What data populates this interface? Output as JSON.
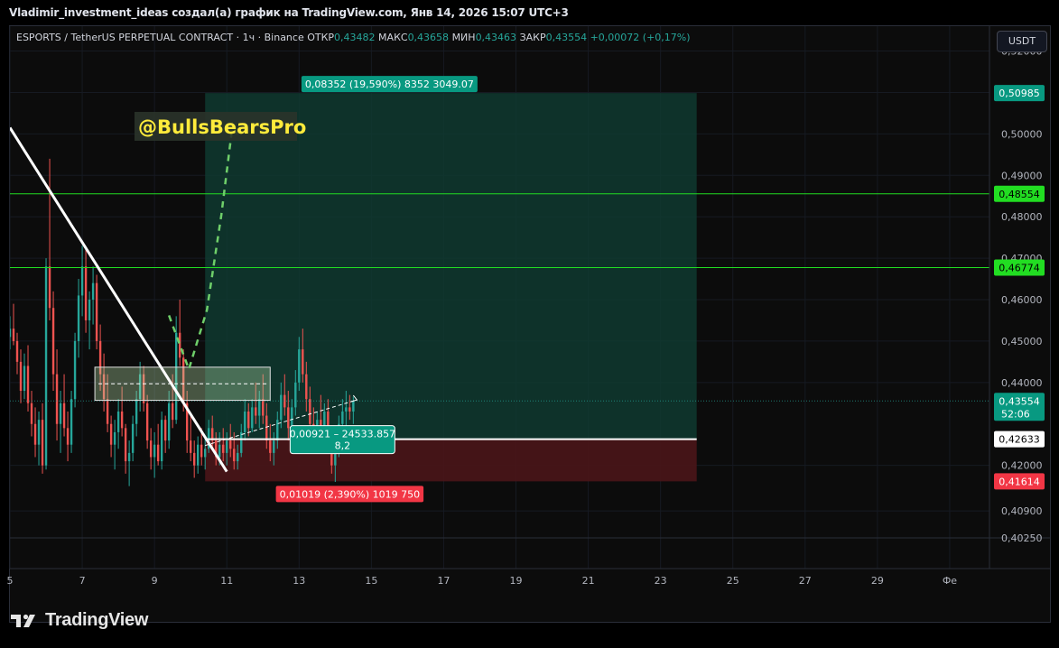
{
  "header": {
    "title": "Vladimir_investment_ideas создал(а) график на TradingView.com, Янв 14, 2026 15:07 UTC+3"
  },
  "legend": {
    "symbol": "ESPORTS / TetherUS PERPETUAL CONTRACT · 1ч · Binance",
    "open_label": "ОТКР",
    "open": "0,43482",
    "high_label": "МАКС",
    "high": "0,43658",
    "low_label": "МИН",
    "low": "0,43463",
    "close_label": "ЗАКР",
    "close": "0,43554",
    "change": "+0,00072 (+0,17%)"
  },
  "currency_button": "USDT",
  "watermark": "@BullsBearsPro",
  "footer": {
    "brand": "TradingView"
  },
  "colors": {
    "up": "#26a69a",
    "down": "#ef5350",
    "target_zone": "#0f3a30",
    "stop_zone": "#4a1518",
    "level_green": "#22dd22",
    "trendline": "#ffffff",
    "watermark_text": "#ffeb3b"
  },
  "chart_data": {
    "type": "candlestick",
    "timeframe": "1h",
    "ylim": [
      0.4025,
      0.526
    ],
    "y_ticks": [
      "0,52000",
      "0,51000",
      "0,50000",
      "0,49000",
      "0,48000",
      "0,47000",
      "0,46000",
      "0,45000",
      "0,44000",
      "0,42000",
      "0,40900",
      "0,40250"
    ],
    "x_ticks": [
      "5",
      "7",
      "9",
      "11",
      "13",
      "15",
      "17",
      "19",
      "21",
      "23",
      "25",
      "27",
      "29",
      "Фе"
    ],
    "x_tick_values": [
      5,
      7,
      9,
      11,
      13,
      15,
      17,
      19,
      21,
      23,
      25,
      27,
      29,
      31
    ],
    "xlim": [
      5,
      32.1
    ],
    "last_price": {
      "value": 0.43554,
      "label": "0,43554",
      "countdown": "52:06"
    },
    "horizontal_levels": [
      {
        "value": 0.48554,
        "label": "0,48554"
      },
      {
        "value": 0.46774,
        "label": "0,46774"
      }
    ],
    "position": {
      "side": "long",
      "entry": 0.42633,
      "entry_label": "0,42633",
      "target": 0.50985,
      "target_label": "0,50985",
      "stop": 0.41614,
      "stop_label": "0,41614",
      "start_day": 10.4,
      "end_day": 24.0,
      "target_text": "0,08352 (19,590%) 8352 3049.07",
      "stop_text": "0,01019 (2,390%) 1019 750",
      "center_text_line1": "0,00921 – 24533.857",
      "center_text_line2": "8,2"
    },
    "trendline": [
      [
        5.0,
        0.5015
      ],
      [
        11.0,
        0.4185
      ]
    ],
    "rectangle": {
      "x1": 7.35,
      "x2": 12.2,
      "top": 0.4437,
      "bottom": 0.4357,
      "mid": 0.4397
    },
    "forecast_path": [
      [
        9.4,
        0.4562
      ],
      [
        9.95,
        0.4432
      ],
      [
        10.45,
        0.4575
      ],
      [
        10.85,
        0.4805
      ],
      [
        11.15,
        0.5015
      ],
      [
        11.05,
        0.5045
      ]
    ],
    "forecast_dashed_line": [
      [
        10.4,
        0.4248
      ],
      [
        14.6,
        0.4358
      ]
    ],
    "candles": [
      [
        5.0,
        0.451,
        0.456,
        0.448,
        0.453
      ],
      [
        5.1,
        0.453,
        0.459,
        0.449,
        0.45
      ],
      [
        5.2,
        0.45,
        0.452,
        0.442,
        0.445
      ],
      [
        5.3,
        0.445,
        0.448,
        0.435,
        0.438
      ],
      [
        5.4,
        0.438,
        0.447,
        0.436,
        0.444
      ],
      [
        5.5,
        0.444,
        0.449,
        0.433,
        0.435
      ],
      [
        5.6,
        0.435,
        0.438,
        0.427,
        0.43
      ],
      [
        5.7,
        0.43,
        0.434,
        0.422,
        0.425
      ],
      [
        5.8,
        0.425,
        0.433,
        0.42,
        0.431
      ],
      [
        5.9,
        0.431,
        0.435,
        0.418,
        0.42
      ],
      [
        6.0,
        0.42,
        0.47,
        0.419,
        0.468
      ],
      [
        6.1,
        0.468,
        0.494,
        0.455,
        0.458
      ],
      [
        6.2,
        0.458,
        0.462,
        0.438,
        0.442
      ],
      [
        6.3,
        0.442,
        0.448,
        0.426,
        0.43
      ],
      [
        6.4,
        0.43,
        0.438,
        0.423,
        0.435
      ],
      [
        6.5,
        0.435,
        0.442,
        0.427,
        0.429
      ],
      [
        6.6,
        0.429,
        0.433,
        0.421,
        0.425
      ],
      [
        6.7,
        0.425,
        0.438,
        0.423,
        0.436
      ],
      [
        6.8,
        0.436,
        0.452,
        0.434,
        0.45
      ],
      [
        6.9,
        0.45,
        0.465,
        0.446,
        0.461
      ],
      [
        7.0,
        0.461,
        0.473,
        0.456,
        0.468
      ],
      [
        7.1,
        0.468,
        0.472,
        0.452,
        0.455
      ],
      [
        7.2,
        0.455,
        0.462,
        0.448,
        0.46
      ],
      [
        7.3,
        0.46,
        0.468,
        0.454,
        0.464
      ],
      [
        7.4,
        0.464,
        0.466,
        0.448,
        0.45
      ],
      [
        7.5,
        0.45,
        0.454,
        0.438,
        0.442
      ],
      [
        7.6,
        0.442,
        0.447,
        0.433,
        0.436
      ],
      [
        7.7,
        0.436,
        0.442,
        0.428,
        0.43
      ],
      [
        7.8,
        0.43,
        0.432,
        0.422,
        0.425
      ],
      [
        7.9,
        0.425,
        0.431,
        0.419,
        0.428
      ],
      [
        8.0,
        0.428,
        0.436,
        0.424,
        0.433
      ],
      [
        8.1,
        0.433,
        0.439,
        0.427,
        0.429
      ],
      [
        8.2,
        0.429,
        0.43,
        0.418,
        0.421
      ],
      [
        8.3,
        0.421,
        0.426,
        0.415,
        0.423
      ],
      [
        8.4,
        0.423,
        0.432,
        0.421,
        0.43
      ],
      [
        8.5,
        0.43,
        0.438,
        0.427,
        0.436
      ],
      [
        8.6,
        0.436,
        0.445,
        0.433,
        0.442
      ],
      [
        8.7,
        0.442,
        0.444,
        0.433,
        0.435
      ],
      [
        8.8,
        0.435,
        0.437,
        0.424,
        0.426
      ],
      [
        8.9,
        0.426,
        0.429,
        0.419,
        0.422
      ],
      [
        9.0,
        0.422,
        0.428,
        0.417,
        0.425
      ],
      [
        9.1,
        0.425,
        0.43,
        0.42,
        0.421
      ],
      [
        9.2,
        0.421,
        0.433,
        0.419,
        0.431
      ],
      [
        9.3,
        0.431,
        0.432,
        0.423,
        0.426
      ],
      [
        9.4,
        0.426,
        0.438,
        0.424,
        0.435
      ],
      [
        9.5,
        0.435,
        0.442,
        0.429,
        0.431
      ],
      [
        9.6,
        0.431,
        0.456,
        0.43,
        0.452
      ],
      [
        9.7,
        0.452,
        0.46,
        0.444,
        0.446
      ],
      [
        9.8,
        0.446,
        0.448,
        0.433,
        0.435
      ],
      [
        9.9,
        0.435,
        0.438,
        0.423,
        0.426
      ],
      [
        10.0,
        0.426,
        0.432,
        0.421,
        0.423
      ],
      [
        10.1,
        0.423,
        0.426,
        0.417,
        0.42
      ],
      [
        10.2,
        0.42,
        0.427,
        0.418,
        0.425
      ],
      [
        10.3,
        0.425,
        0.429,
        0.42,
        0.422
      ],
      [
        10.4,
        0.422,
        0.427,
        0.419,
        0.424
      ],
      [
        10.5,
        0.424,
        0.431,
        0.423,
        0.429
      ],
      [
        10.6,
        0.429,
        0.432,
        0.424,
        0.426
      ],
      [
        10.7,
        0.426,
        0.428,
        0.42,
        0.422
      ],
      [
        10.8,
        0.422,
        0.428,
        0.42,
        0.425
      ],
      [
        10.9,
        0.425,
        0.429,
        0.421,
        0.423
      ],
      [
        11.0,
        0.423,
        0.428,
        0.42,
        0.426
      ],
      [
        11.1,
        0.426,
        0.43,
        0.422,
        0.424
      ],
      [
        11.2,
        0.424,
        0.428,
        0.419,
        0.421
      ],
      [
        11.3,
        0.421,
        0.425,
        0.419,
        0.423
      ],
      [
        11.4,
        0.423,
        0.43,
        0.422,
        0.428
      ],
      [
        11.5,
        0.428,
        0.436,
        0.426,
        0.433
      ],
      [
        11.6,
        0.433,
        0.435,
        0.427,
        0.429
      ],
      [
        11.7,
        0.429,
        0.436,
        0.428,
        0.434
      ],
      [
        11.8,
        0.434,
        0.44,
        0.43,
        0.432
      ],
      [
        11.9,
        0.432,
        0.438,
        0.429,
        0.436
      ],
      [
        12.0,
        0.436,
        0.442,
        0.43,
        0.432
      ],
      [
        12.1,
        0.432,
        0.435,
        0.424,
        0.426
      ],
      [
        12.2,
        0.426,
        0.43,
        0.421,
        0.423
      ],
      [
        12.3,
        0.423,
        0.428,
        0.42,
        0.426
      ],
      [
        12.4,
        0.426,
        0.433,
        0.424,
        0.431
      ],
      [
        12.5,
        0.431,
        0.44,
        0.429,
        0.437
      ],
      [
        12.6,
        0.437,
        0.442,
        0.432,
        0.434
      ],
      [
        12.7,
        0.434,
        0.438,
        0.426,
        0.429
      ],
      [
        12.8,
        0.429,
        0.436,
        0.427,
        0.434
      ],
      [
        12.9,
        0.434,
        0.443,
        0.432,
        0.44
      ],
      [
        13.0,
        0.44,
        0.451,
        0.438,
        0.448
      ],
      [
        13.1,
        0.448,
        0.453,
        0.44,
        0.442
      ],
      [
        13.2,
        0.442,
        0.445,
        0.433,
        0.436
      ],
      [
        13.3,
        0.436,
        0.439,
        0.427,
        0.43
      ],
      [
        13.4,
        0.43,
        0.434,
        0.424,
        0.426
      ],
      [
        13.5,
        0.426,
        0.433,
        0.424,
        0.431
      ],
      [
        13.6,
        0.431,
        0.437,
        0.426,
        0.428
      ],
      [
        13.7,
        0.428,
        0.435,
        0.427,
        0.433
      ],
      [
        13.8,
        0.433,
        0.436,
        0.425,
        0.427
      ],
      [
        13.9,
        0.427,
        0.429,
        0.418,
        0.42
      ],
      [
        14.0,
        0.42,
        0.426,
        0.416,
        0.424
      ],
      [
        14.1,
        0.424,
        0.432,
        0.422,
        0.43
      ],
      [
        14.2,
        0.43,
        0.436,
        0.427,
        0.433
      ],
      [
        14.3,
        0.433,
        0.438,
        0.429,
        0.434
      ],
      [
        14.4,
        0.434,
        0.437,
        0.431,
        0.433
      ],
      [
        14.5,
        0.433,
        0.4366,
        0.43,
        0.4355
      ]
    ]
  }
}
